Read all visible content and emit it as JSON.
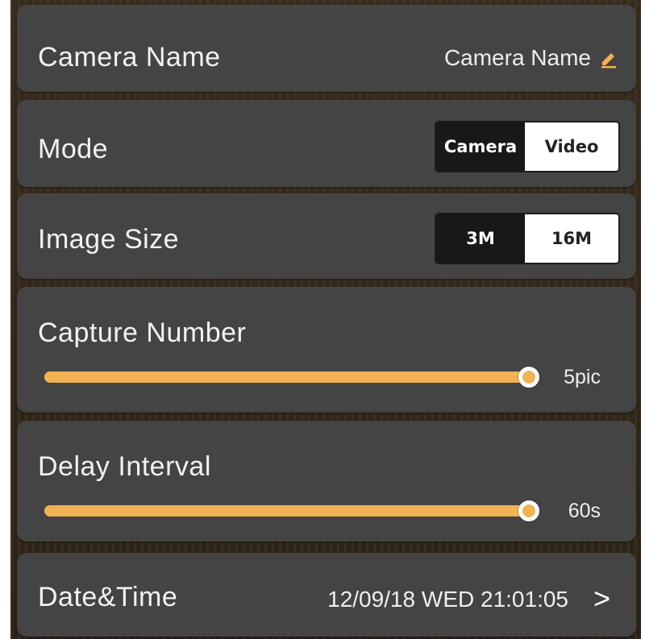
{
  "camera_name": {
    "label": "Camera  Name",
    "value": "Camera Name",
    "edit_icon": "pencil-icon",
    "accent": "#f0b253"
  },
  "mode": {
    "label": "Mode",
    "options": [
      "Camera",
      "Video"
    ],
    "selected": "Camera"
  },
  "image_size": {
    "label": "Image Size",
    "options": [
      "3M",
      "16M"
    ],
    "selected": "3M"
  },
  "capture_number": {
    "label": "Capture Number",
    "value_text": "5pic",
    "level": 1.0
  },
  "delay_interval": {
    "label": "Delay Interval",
    "value_text": "60s",
    "level": 1.0
  },
  "date_time": {
    "label": "Date&Time",
    "value": "12/09/18 WED 21:01:05",
    "chevron": ">"
  },
  "colors": {
    "card": "#444444",
    "slider": "#f0b253",
    "segment_selected": "#181818",
    "segment_unselected": "#ffffff"
  }
}
